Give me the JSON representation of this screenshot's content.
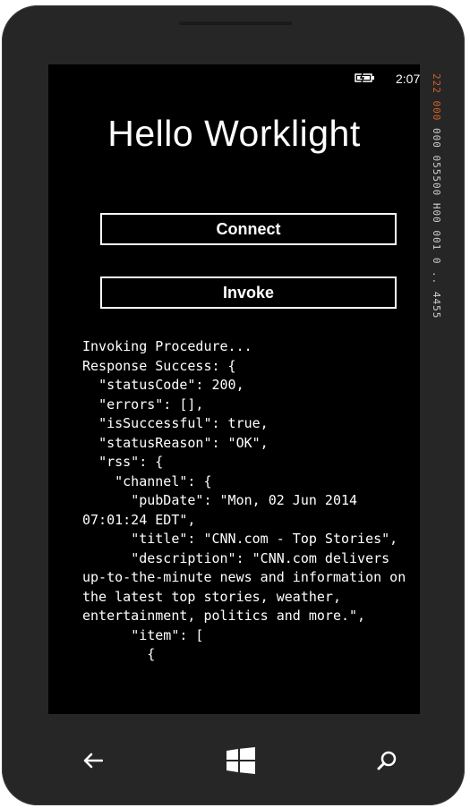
{
  "status_bar": {
    "time": "2:07",
    "battery_icon": "battery-charging-icon"
  },
  "debug_counters": {
    "warn_segment": "222 000",
    "normal_segment": "000 055500 H00 001 0 .. 4455"
  },
  "app": {
    "title": "Hello Worklight"
  },
  "buttons": {
    "connect_label": "Connect",
    "invoke_label": "Invoke"
  },
  "log": {
    "text": "Invoking Procedure...\nResponse Success: {\n  \"statusCode\": 200,\n  \"errors\": [],\n  \"isSuccessful\": true,\n  \"statusReason\": \"OK\",\n  \"rss\": {\n    \"channel\": {\n      \"pubDate\": \"Mon, 02 Jun 2014 07:01:24 EDT\",\n      \"title\": \"CNN.com - Top Stories\",\n      \"description\": \"CNN.com delivers up-to-the-minute news and information on the latest top stories, weather, entertainment, politics and more.\",\n      \"item\": [\n        {"
  },
  "nav_bar": {
    "back_icon": "back-arrow-icon",
    "start_icon": "windows-start-icon",
    "search_icon": "search-icon"
  }
}
